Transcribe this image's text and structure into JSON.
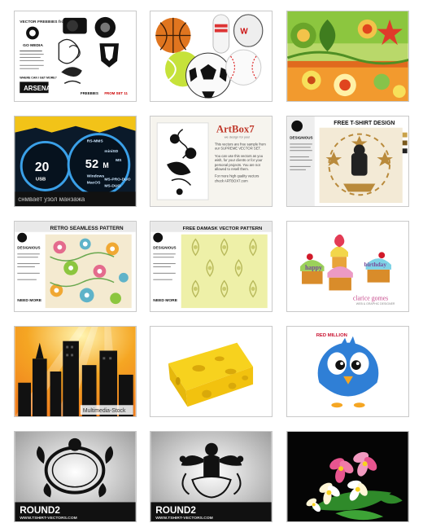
{
  "thumbnails": [
    {
      "name": "vector-freebies",
      "title": "VECTOR FREEBIES from",
      "brand": "GO MEDIA",
      "tag1": "FREEBIES",
      "tag2": "FROM SET 11",
      "caption": "ARSENAL",
      "sub": "WHERE CAN I GET MORE?"
    },
    {
      "name": "sports-balls"
    },
    {
      "name": "floral-wallpaper"
    },
    {
      "name": "speedometer",
      "gauge_left": "20",
      "gauge_right": "52",
      "gauge_right_unit": "M",
      "items": [
        "RS-MMS",
        "miniSD",
        "MS",
        "Windows",
        "MacOS",
        "MS-PRO-DUO",
        "USB",
        "MS-DUO"
      ],
      "banner": "снмвает узол манзажа"
    },
    {
      "name": "artbox",
      "title": "ArtBox7",
      "subtitle": "we design for you!",
      "p1": "This vectors are free sample from our SUPREME VECTOR SET.",
      "p2": "You can use this vectors as you wish, for your clients or for your personal projects. You are not allowed to resell them.",
      "p3": "For more high quality vectors check ARTBOX7.com"
    },
    {
      "name": "free-tshirt",
      "title": "FREE T-SHIRT DESIGN",
      "brand": "DESIGNIOUS"
    },
    {
      "name": "retro-pattern",
      "title": "RETRO SEAMLESS PATTERN",
      "brand": "DESIGNIOUS",
      "more": "NEED MORE"
    },
    {
      "name": "damask-pattern",
      "title": "FREE DAMASK VECTOR PATTERN",
      "brand": "DESIGNIOUS",
      "more": "NEED MORE"
    },
    {
      "name": "cupcakes",
      "word1": "happy",
      "word2": "birthday",
      "brand": "clarice gomes",
      "sub": "WEB & GRAPHIC DESIGNER"
    },
    {
      "name": "city-skyline",
      "caption": "Multimedia-Stock"
    },
    {
      "name": "cheese"
    },
    {
      "name": "blue-bird",
      "logo": "RED MILLION"
    },
    {
      "name": "ornament-frame",
      "brand": "ROUND2",
      "url": "WWW.TSHIRT-VECTORS.COM"
    },
    {
      "name": "ornament-cherub",
      "brand": "ROUND2",
      "url": "WWW.TSHIRT-VECTORS.COM"
    },
    {
      "name": "frangipani"
    }
  ],
  "colors": {
    "border": "#c9c9c9",
    "tile_bg": "#ffffff",
    "floral_green": "#8cc63f",
    "gauge_blue": "#3aa0e8",
    "sky_orange": "#f5a623",
    "cheese_yellow": "#f7d21e",
    "bird_blue": "#2f7fd6",
    "flower_pink": "#e8558f"
  }
}
